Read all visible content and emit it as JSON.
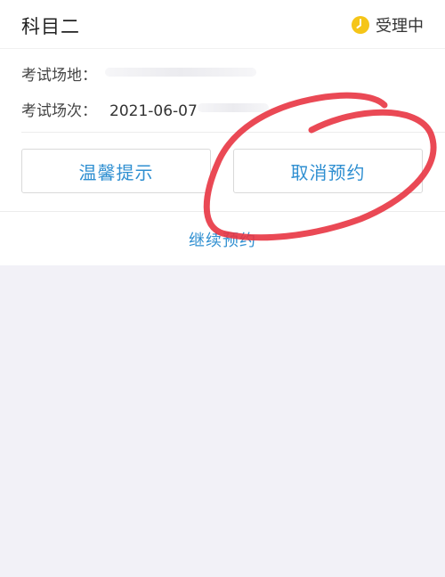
{
  "header": {
    "subject": "科目二",
    "status_text": "受理中",
    "status_icon": "clock-icon",
    "status_icon_color": "#f5c518"
  },
  "details": {
    "venue_label": "考试场地：",
    "session_label": "考试场次：",
    "session_value": "2021-06-07"
  },
  "actions": {
    "tip_label": "温馨提示",
    "cancel_label": "取消预约",
    "continue_label": "继续预约"
  },
  "colors": {
    "accent": "#2f8fd1",
    "annotation": "#e83543",
    "background": "#f2f1f7"
  }
}
